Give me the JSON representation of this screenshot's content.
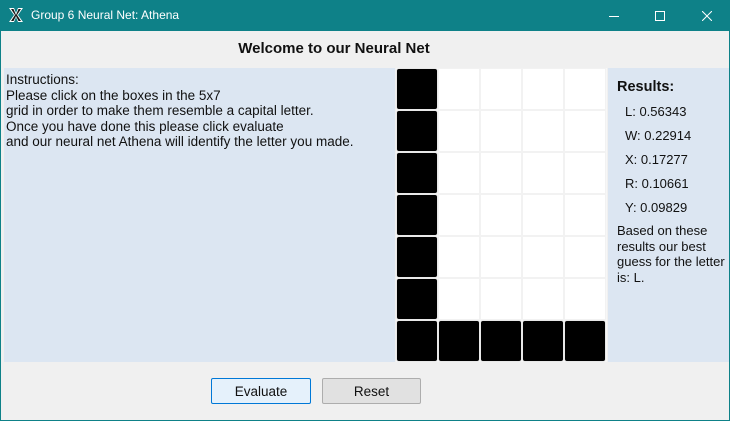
{
  "window": {
    "title": "Group 6 Neural Net: Athena",
    "icon": "x-app-icon",
    "titlebar_color": "#0e8188"
  },
  "heading": "Welcome to our Neural Net",
  "instructions": [
    "Instructions:",
    "Please click on the boxes in the 5x7",
    "grid in order to make them resemble a capital letter.",
    "Once you have done this please click evaluate",
    "and our neural net Athena will identify the letter you made."
  ],
  "grid": {
    "columns": 5,
    "rows": 7,
    "cells": [
      [
        1,
        0,
        0,
        0,
        0
      ],
      [
        1,
        0,
        0,
        0,
        0
      ],
      [
        1,
        0,
        0,
        0,
        0
      ],
      [
        1,
        0,
        0,
        0,
        0
      ],
      [
        1,
        0,
        0,
        0,
        0
      ],
      [
        1,
        0,
        0,
        0,
        0
      ],
      [
        1,
        1,
        1,
        1,
        1
      ]
    ]
  },
  "results": {
    "title": "Results:",
    "items": [
      "L: 0.56343",
      "W: 0.22914",
      "X: 0.17277",
      "R: 0.10661",
      "Y: 0.09829"
    ],
    "guess": "Based on these results our best guess for the letter is: L."
  },
  "buttons": {
    "evaluate": "Evaluate",
    "reset": "Reset"
  },
  "colors": {
    "panel": "#dce6f2",
    "cell_on": "#000000",
    "cell_off": "#ffffff"
  }
}
